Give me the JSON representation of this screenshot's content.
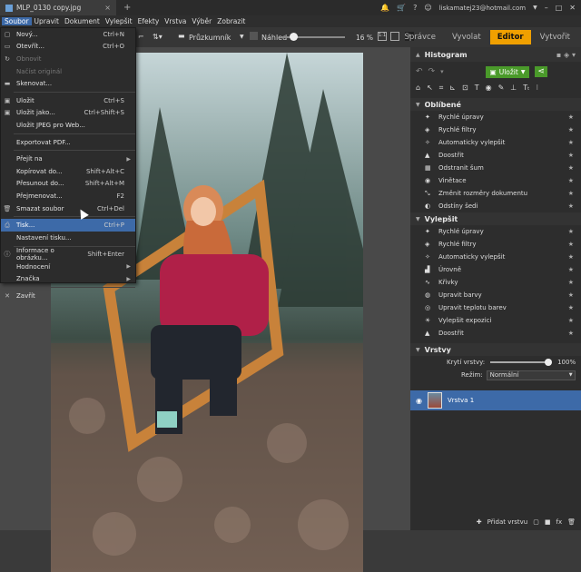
{
  "titlebar": {
    "doc_title": "MLP_0130 copy.jpg",
    "close": "×",
    "add_tab": "+",
    "user": "liskamatej23@hotmail.com"
  },
  "menubar": [
    "Soubor",
    "Upravit",
    "Dokument",
    "Vylepšit",
    "Efekty",
    "Vrstva",
    "Výběr",
    "Zobrazit"
  ],
  "toolbar": {
    "tool_name": "Průzkumník",
    "preview_label": "Náhled",
    "zoom": "16 %",
    "modes": [
      "Správce",
      "Vyvolat",
      "Editor",
      "Vytvořit"
    ],
    "active_mode": "Editor"
  },
  "file_menu": [
    {
      "label": "Nový...",
      "shortcut": "Ctrl+N",
      "icon": "new-doc-icon",
      "glyph": "▢"
    },
    {
      "label": "Otevřít...",
      "shortcut": "Ctrl+O",
      "icon": "folder-icon",
      "glyph": "▭"
    },
    {
      "label": "Obnovit",
      "shortcut": "",
      "icon": "refresh-icon",
      "glyph": "↻",
      "disabled": true
    },
    {
      "label": "Načíst originál",
      "shortcut": "",
      "icon": "",
      "glyph": "",
      "disabled": true
    },
    {
      "label": "Skenovat...",
      "shortcut": "",
      "icon": "scanner-icon",
      "glyph": "▬"
    },
    {
      "sep": true
    },
    {
      "label": "Uložit",
      "shortcut": "Ctrl+S",
      "icon": "save-icon",
      "glyph": "▣"
    },
    {
      "label": "Uložit jako...",
      "shortcut": "Ctrl+Shift+S",
      "icon": "save-as-icon",
      "glyph": "▣"
    },
    {
      "label": "Uložit JPEG pro Web...",
      "shortcut": "",
      "icon": "",
      "glyph": ""
    },
    {
      "sep": true
    },
    {
      "label": "Exportovat PDF...",
      "shortcut": "",
      "icon": "",
      "glyph": ""
    },
    {
      "sep": true
    },
    {
      "label": "Přejít na",
      "shortcut": "",
      "icon": "",
      "glyph": "",
      "submenu": true
    },
    {
      "label": "Kopírovat do...",
      "shortcut": "Shift+Alt+C",
      "icon": "",
      "glyph": ""
    },
    {
      "label": "Přesunout do...",
      "shortcut": "Shift+Alt+M",
      "icon": "",
      "glyph": ""
    },
    {
      "label": "Přejmenovat...",
      "shortcut": "F2",
      "icon": "",
      "glyph": ""
    },
    {
      "label": "Smazat soubor",
      "shortcut": "Ctrl+Del",
      "icon": "trash-icon",
      "glyph": "🗑"
    },
    {
      "sep": true
    },
    {
      "label": "Tisk...",
      "shortcut": "Ctrl+P",
      "icon": "printer-icon",
      "glyph": "⎙",
      "highlighted": true
    },
    {
      "label": "Nastavení tisku...",
      "shortcut": "",
      "icon": "",
      "glyph": ""
    },
    {
      "sep": true
    },
    {
      "label": "Informace o obrázku...",
      "shortcut": "Shift+Enter",
      "icon": "info-icon",
      "glyph": "ⓘ"
    },
    {
      "label": "Hodnocení",
      "shortcut": "",
      "icon": "",
      "glyph": "",
      "submenu": true
    },
    {
      "label": "Značka",
      "shortcut": "",
      "icon": "",
      "glyph": "",
      "submenu": true
    },
    {
      "sep": true
    },
    {
      "label": "Zavřít",
      "shortcut": "",
      "icon": "close-x-icon",
      "glyph": "✕"
    }
  ],
  "right_panel": {
    "histogram_title": "Histogram",
    "save_label": "Uložit",
    "favorites_title": "Oblíbené",
    "favorites": [
      {
        "label": "Rychlé úpravy",
        "icon": "magic-wand-icon",
        "glyph": "✦"
      },
      {
        "label": "Rychlé filtry",
        "icon": "filter-icon",
        "glyph": "◈"
      },
      {
        "label": "Automaticky vylepšit",
        "icon": "auto-enhance-icon",
        "glyph": "✧"
      },
      {
        "label": "Doostřit",
        "icon": "sharpen-icon",
        "glyph": "▲"
      },
      {
        "label": "Odstranit šum",
        "icon": "noise-icon",
        "glyph": "▦"
      },
      {
        "label": "Vinětace",
        "icon": "vignette-icon",
        "glyph": "◉"
      },
      {
        "label": "Změnit rozměry dokumentu",
        "icon": "resize-icon",
        "glyph": "⤡"
      },
      {
        "label": "Odstíny šedi",
        "icon": "grayscale-icon",
        "glyph": "◐"
      }
    ],
    "enhance_title": "Vylepšit",
    "enhance": [
      {
        "label": "Rychlé úpravy",
        "icon": "magic-wand-icon",
        "glyph": "✦"
      },
      {
        "label": "Rychlé filtry",
        "icon": "filter-icon",
        "glyph": "◈"
      },
      {
        "label": "Automaticky vylepšit",
        "icon": "auto-enhance-icon",
        "glyph": "✧"
      },
      {
        "label": "Úrovně",
        "icon": "levels-icon",
        "glyph": "▟"
      },
      {
        "label": "Křivky",
        "icon": "curves-icon",
        "glyph": "∿"
      },
      {
        "label": "Upravit barvy",
        "icon": "palette-icon",
        "glyph": "◍"
      },
      {
        "label": "Upravit teplotu barev",
        "icon": "bulb-icon",
        "glyph": "◎"
      },
      {
        "label": "Vylepšit expozici",
        "icon": "sun-icon",
        "glyph": "☀"
      },
      {
        "label": "Doostřit",
        "icon": "sharpen-icon",
        "glyph": "▲"
      }
    ],
    "layers_title": "Vrstvy",
    "opacity_label": "Krytí vrstvy:",
    "opacity_value": "100%",
    "opacity_fraction": 1.0,
    "blend_label": "Režim:",
    "blend_value": "Normální",
    "layer_name": "Vrstva 1",
    "add_layer_label": "Přidat vrstvu"
  }
}
